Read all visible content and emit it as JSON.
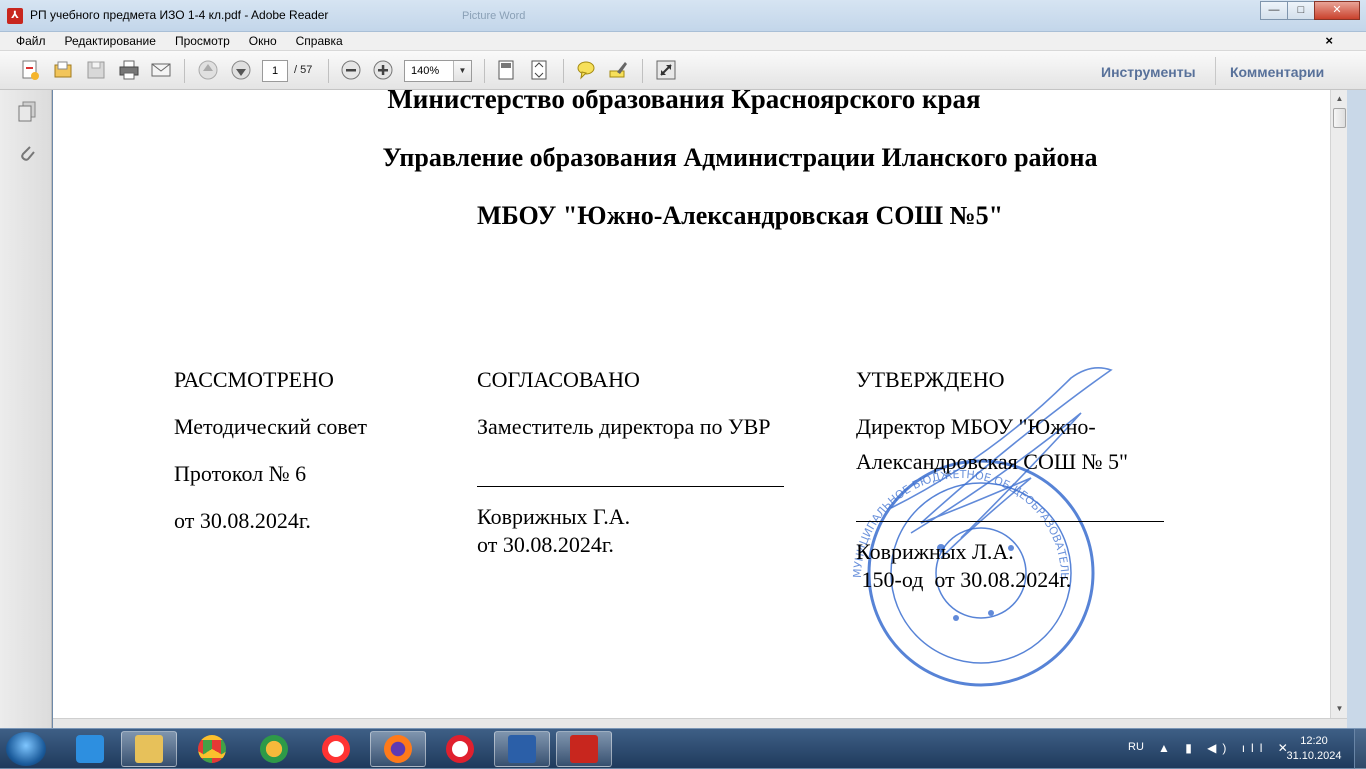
{
  "window": {
    "title": "РП учебного предмета ИЗО 1-4 кл.pdf - Adobe Reader",
    "ghost_tab": "Picture Word",
    "minimize": "—",
    "maximize": "□",
    "close": "✕"
  },
  "menu": {
    "items": [
      "Файл",
      "Редактирование",
      "Просмотр",
      "Окно",
      "Справка"
    ],
    "close": "×"
  },
  "toolbar": {
    "page_current": "1",
    "page_total": "/  57",
    "zoom": "140%",
    "zoom_arrow": "▼",
    "tools_label": "Инструменты",
    "comments_label": "Комментарии"
  },
  "document": {
    "headings": [
      "Министерство образования Красноярского края",
      "Управление образования Администрации Иланского района",
      "МБОУ \"Южно-Александровская СОШ №5\""
    ],
    "col1": {
      "title": "РАССМОТРЕНО",
      "line1": "Методический совет",
      "line2": "Протокол № 6",
      "line3": "от 30.08.2024г."
    },
    "col2": {
      "title": "СОГЛАСОВАНО",
      "line1": "Заместитель директора по УВР",
      "name": "Коврижных Г.А.",
      "date": "от 30.08.2024г."
    },
    "col3": {
      "title": "УТВЕРЖДЕНО",
      "line1": "Директор МБОУ \"Южно-",
      "line2": "Александровская СОШ № 5\"",
      "name": "Коврижных Л.А.",
      "order": " 150-од  от 30.08.2024г."
    },
    "stamp_text": "МУНИЦИПАЛЬНОЕ БЮДЖЕТНОЕ ОБЩЕОБРАЗОВАТЕЛЬНОЕ УЧРЕЖДЕНИЕ ЮЖНО-АЛЕКСАНДРОВСКАЯ СРЕДНЯЯ ОБЩЕОБРАЗОВАТЕЛЬНАЯ ШКОЛА № 5"
  },
  "scrollbar": {
    "up": "▲",
    "down": "▼"
  },
  "taskbar": {
    "lang": "RU",
    "tray": "▲ ▮ ◀) ıll ✕",
    "time": "12:20",
    "date": "31.10.2024"
  },
  "colors": {
    "stamp_blue": "#3a6ed0",
    "link_blue": "#58719a",
    "taskbar": "#2b4a70"
  }
}
